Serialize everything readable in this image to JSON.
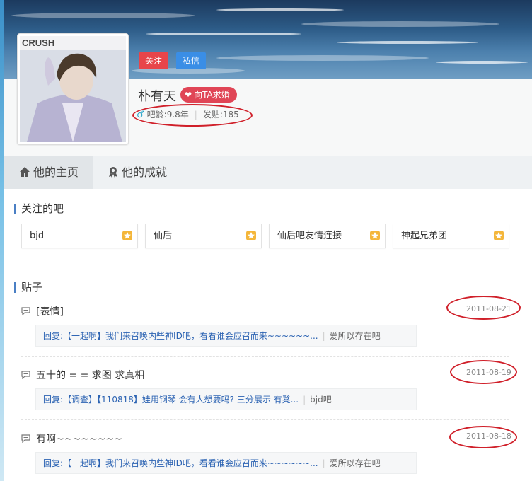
{
  "profile": {
    "username": "朴有天",
    "follow_label": "关注",
    "message_label": "私信",
    "propose_label": "向TA求婚",
    "bar_age": "吧龄:9.8年",
    "post_count": "发贴:185",
    "avatar_text": "CRUSH"
  },
  "tabs": [
    {
      "label": "他的主页",
      "active": true
    },
    {
      "label": "他的成就",
      "active": false
    }
  ],
  "followed_section": {
    "title": "关注的吧",
    "bars": [
      {
        "name": "bjd"
      },
      {
        "name": "仙后"
      },
      {
        "name": "仙后吧友情连接"
      },
      {
        "name": "神起兄弟团"
      }
    ]
  },
  "posts_section": {
    "title": "贴子",
    "posts": [
      {
        "title": "[表情]",
        "date": "2011-08-21",
        "reply_label": "回复:",
        "reply_text": "【一起啊】我们来召唤内些神ID吧，看看谁会应召而来~~~~~~...",
        "reply_bar": "爱所以存在吧"
      },
      {
        "title": "五十的 = = 求图 求真相",
        "date": "2011-08-19",
        "reply_label": "回复:",
        "reply_text": "【调查】【110818】娃用钢琴 会有人想要吗? 三分展示 有凳...",
        "reply_bar": "bjd吧"
      },
      {
        "title": "有啊~~~~~~~~",
        "date": "2011-08-18",
        "reply_label": "回复:",
        "reply_text": "【一起啊】我们来召唤内些神ID吧，看看谁会应召而来~~~~~~...",
        "reply_bar": "爱所以存在吧"
      }
    ]
  },
  "colors": {
    "accent_red": "#e8454a",
    "accent_blue": "#3a8ee6",
    "link_blue": "#2d64b3",
    "annotation_red": "#d0202a"
  }
}
